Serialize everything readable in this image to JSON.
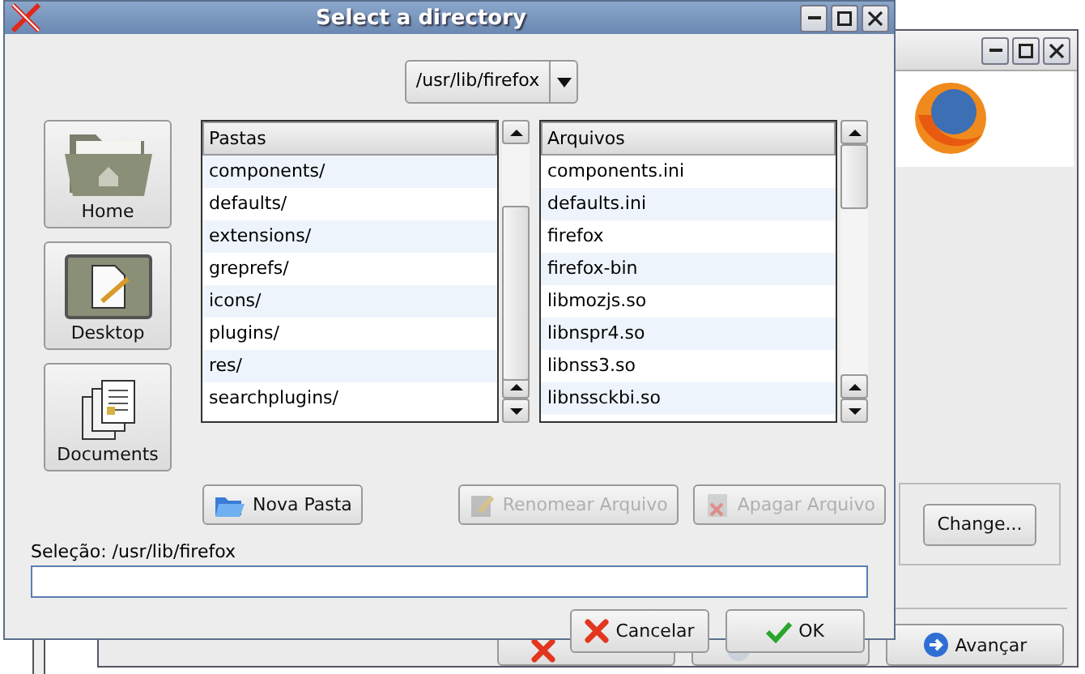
{
  "background_window": {
    "change_button": {
      "label": "Change..."
    },
    "footer_buttons": [
      {
        "kind": "cancel"
      },
      {
        "kind": "back"
      },
      {
        "label": "Avançar",
        "kind": "forward",
        "disabled": false
      }
    ]
  },
  "dialog": {
    "title": "Select a directory",
    "path": "/usr/lib/firefox",
    "places": [
      {
        "label": "Home",
        "kind": "home"
      },
      {
        "label": "Desktop",
        "kind": "desktop"
      },
      {
        "label": "Documents",
        "kind": "documents"
      }
    ],
    "folders": {
      "header": "Pastas",
      "items": [
        "components/",
        "defaults/",
        "extensions/",
        "greprefs/",
        "icons/",
        "plugins/",
        "res/",
        "searchplugins/"
      ]
    },
    "files": {
      "header": "Arquivos",
      "items": [
        "components.ini",
        "defaults.ini",
        "firefox",
        "firefox-bin",
        "libmozjs.so",
        "libnspr4.so",
        "libnss3.so",
        "libnssckbi.so"
      ]
    },
    "actions": [
      {
        "label": "Nova Pasta",
        "kind": "new-folder",
        "disabled": false
      },
      {
        "label": "Renomear Arquivo",
        "kind": "rename",
        "disabled": true
      },
      {
        "label": "Apagar Arquivo",
        "kind": "delete",
        "disabled": true
      }
    ],
    "selection_label": "Seleção: /usr/lib/firefox",
    "buttons": [
      {
        "label": "Cancelar",
        "kind": "cancel"
      },
      {
        "label": "OK",
        "kind": "ok"
      }
    ]
  }
}
